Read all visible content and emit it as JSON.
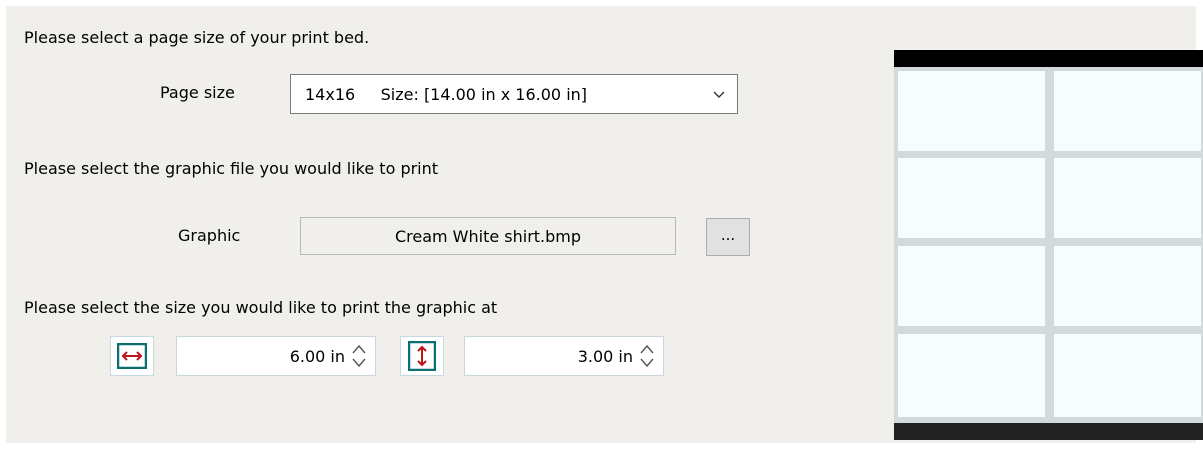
{
  "page_size": {
    "prompt": "Please select a page size of your print bed.",
    "label": "Page size",
    "selected": "14x16     Size: [14.00 in x 16.00 in]"
  },
  "graphic": {
    "prompt": "Please select the graphic file you would like to print",
    "label": "Graphic",
    "file_name": "Cream White shirt.bmp",
    "browse_label": "..."
  },
  "print_size": {
    "prompt": "Please select the size you would like to print the graphic at",
    "width_value": "6.00 in",
    "height_value": "3.00 in"
  },
  "colors": {
    "accent_teal": "#0e6f73",
    "arrow_red": "#c0141c",
    "panel_bg": "#f0efeb"
  }
}
